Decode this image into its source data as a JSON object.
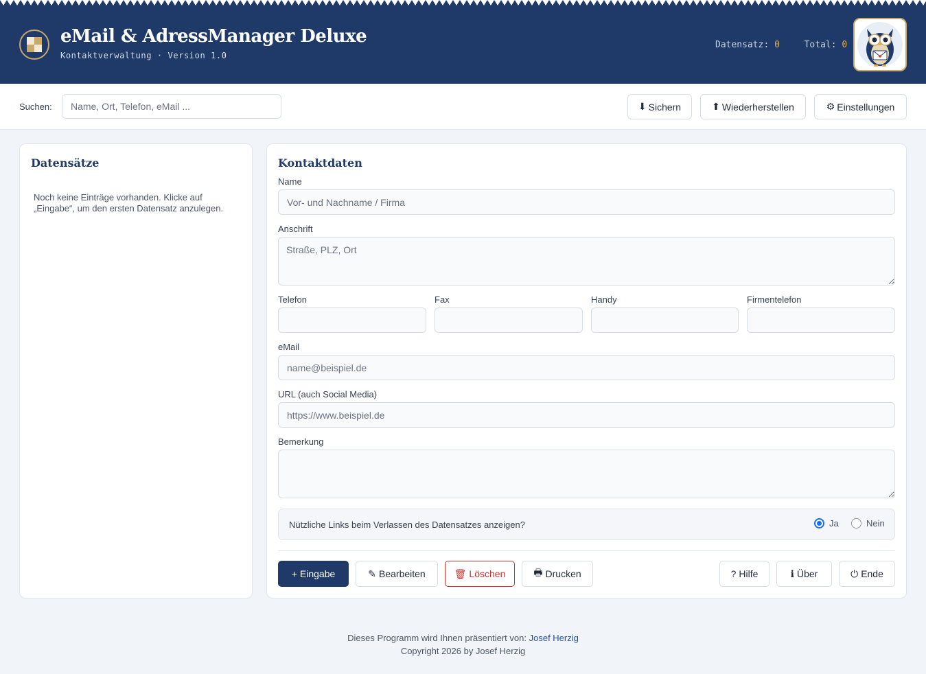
{
  "header": {
    "title": "eMail & AdressManager Deluxe",
    "subtitle": "Kontaktverwaltung · Version 1.0",
    "record_label": "Datensatz:",
    "record_value": "0",
    "total_label": "Total:",
    "total_value": "0",
    "logo_icon": "checker-logo-icon",
    "mascot_icon": "owl-mascot-icon"
  },
  "toolbar": {
    "search_label": "Suchen:",
    "search_placeholder": "Name, Ort, Telefon, eMail ...",
    "search_value": "",
    "save_icon": "⬇",
    "save_label": "Sichern",
    "restore_icon": "⬆",
    "restore_label": "Wiederherstellen",
    "settings_icon": "⚙",
    "settings_label": "Einstellungen"
  },
  "records": {
    "title": "Datensätze",
    "empty_text": "Noch keine Einträge vorhanden. Klicke auf „Eingabe“, um den ersten Datensatz anzulegen."
  },
  "form": {
    "title": "Kontaktdaten",
    "name": {
      "label": "Name",
      "placeholder": "Vor- und Nachname / Firma",
      "value": ""
    },
    "address": {
      "label": "Anschrift",
      "placeholder": "Straße, PLZ, Ort",
      "value": ""
    },
    "phone": {
      "label": "Telefon",
      "value": ""
    },
    "fax": {
      "label": "Fax",
      "value": ""
    },
    "mobile": {
      "label": "Handy",
      "value": ""
    },
    "company_phone": {
      "label": "Firmentelefon",
      "value": ""
    },
    "email": {
      "label": "eMail",
      "placeholder": "name@beispiel.de",
      "value": ""
    },
    "url": {
      "label": "URL (auch Social Media)",
      "placeholder": "https://www.beispiel.de",
      "value": ""
    },
    "remark": {
      "label": "Bemerkung",
      "value": ""
    },
    "links_question": "Nützliche Links beim Verlassen des Datensatzes anzeigen?",
    "links_yes": "Ja",
    "links_no": "Nein",
    "links_selected": "Ja"
  },
  "actions": {
    "add_icon": "+",
    "add_label": "Eingabe",
    "edit_icon": "✎",
    "edit_label": "Bearbeiten",
    "delete_icon": "🗑",
    "delete_label": "Löschen",
    "print_icon": "🖶",
    "print_label": "Drucken",
    "help_icon": "?",
    "help_label": "Hilfe",
    "about_icon": "ℹ",
    "about_label": "Über",
    "exit_icon": "⏻",
    "exit_label": "Ende"
  },
  "footer": {
    "presented_by": "Dieses Programm wird Ihnen präsentiert von:",
    "author_link": "Josef Herzig",
    "copyright": "Copyright 2026 by Josef Herzig"
  },
  "colors": {
    "header_bg": "#1f3a68",
    "accent_gold": "#c9a86a",
    "counter_value": "#e3b04b",
    "danger": "#c9302c",
    "radio_blue": "#1a6ff0",
    "page_bg": "#f1f4f8"
  }
}
